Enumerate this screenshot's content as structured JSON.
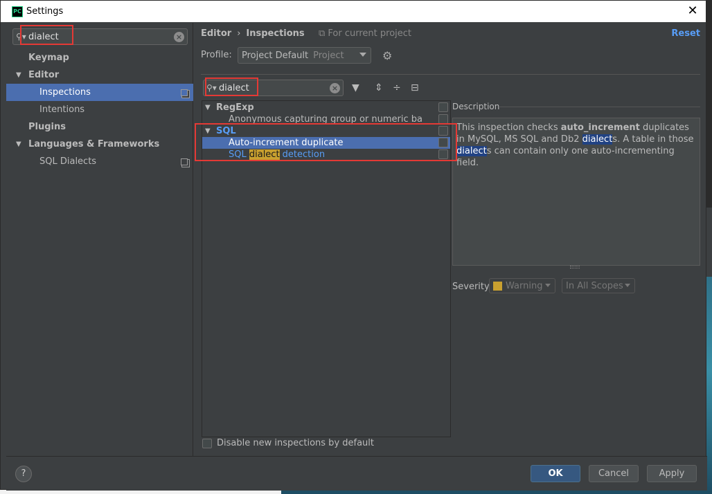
{
  "window": {
    "title": "Settings",
    "app_icon": "PC",
    "close_glyph": "✕"
  },
  "sidebar": {
    "search_value": "dialect",
    "items": [
      {
        "label": "Keymap"
      },
      {
        "label": "Editor"
      },
      {
        "label": "Inspections"
      },
      {
        "label": "Intentions"
      },
      {
        "label": "Plugins"
      },
      {
        "label": "Languages & Frameworks"
      },
      {
        "label": "SQL Dialects"
      }
    ]
  },
  "main": {
    "breadcrumb": {
      "parent": "Editor",
      "separator": "›",
      "current": "Inspections"
    },
    "scope_note": "For current project",
    "reset_label": "Reset",
    "profile": {
      "label": "Profile:",
      "value": "Project Default",
      "sub": "Project"
    },
    "filter_value": "dialect",
    "tree": {
      "group_regexp": "RegExp",
      "regexp_item": "Anonymous capturing group or numeric back re",
      "group_sql": "SQL",
      "sql_item_1": "Auto-increment duplicate",
      "sql_item_2_pre": "SQL ",
      "sql_item_2_hl": "dialect",
      "sql_item_2_post": " detection"
    },
    "description": {
      "title": "Description",
      "p1": "This inspection checks ",
      "bold": "auto_increment",
      "p2": " duplicates in MySQL, MS SQL and Db2 ",
      "word1": "dialect",
      "p3": "s. A table in those ",
      "word2": "dialect",
      "p4": "s can contain only one auto-incrementing field."
    },
    "severity": {
      "label": "Severity:",
      "value": "Warning",
      "scope": "In All Scopes",
      "warning_color": "#c9a02f"
    },
    "disable_new_label": "Disable new inspections by default"
  },
  "footer": {
    "help": "?",
    "ok": "OK",
    "cancel": "Cancel",
    "apply": "Apply"
  },
  "colors": {
    "accent": "#4b6eaf",
    "link": "#589df6",
    "annotation": "#e53935"
  }
}
